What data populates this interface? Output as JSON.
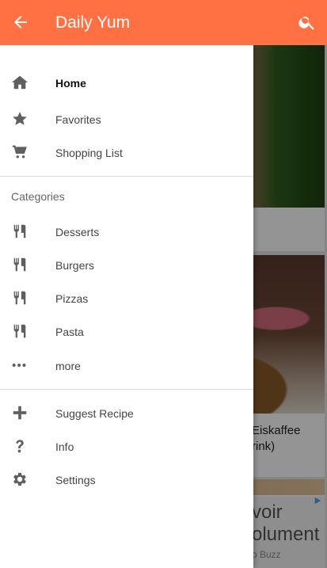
{
  "appbar": {
    "title": "Daily Yum",
    "back_icon": "arrow-back-icon",
    "search_icon": "search-icon",
    "color": "#FF7043"
  },
  "drawer": {
    "main_items": [
      {
        "label": "Home",
        "icon": "home-icon",
        "active": true
      },
      {
        "label": "Favorites",
        "icon": "star-icon"
      },
      {
        "label": "Shopping List",
        "icon": "cart-icon"
      }
    ],
    "categories_header": "Categories",
    "category_items": [
      {
        "label": "Desserts",
        "icon": "utensils-icon"
      },
      {
        "label": "Burgers",
        "icon": "utensils-icon"
      },
      {
        "label": "Pizzas",
        "icon": "utensils-icon"
      },
      {
        "label": "Pasta",
        "icon": "utensils-icon"
      },
      {
        "label": "more",
        "icon": "more-icon"
      }
    ],
    "footer_items": [
      {
        "label": "Suggest Recipe",
        "icon": "plus-icon"
      },
      {
        "label": "Info",
        "icon": "question-icon"
      },
      {
        "label": "Settings",
        "icon": "gear-icon"
      }
    ]
  },
  "background": {
    "card2_caption": "Eiskaffee\nrink)",
    "ad_line1": "voir",
    "ad_line2": "olument",
    "ad_line3": "o Buzz"
  }
}
